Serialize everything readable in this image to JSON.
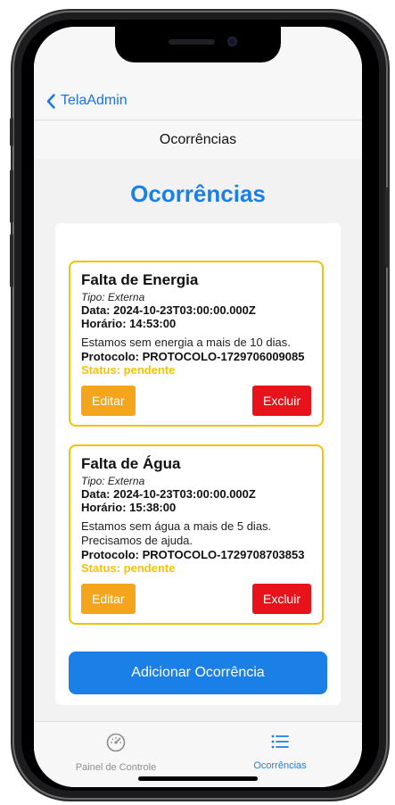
{
  "nav": {
    "back_label": "TelaAdmin",
    "title": "Ocorrências"
  },
  "page": {
    "heading": "Ocorrências"
  },
  "occurrences": [
    {
      "title": "Falta de Energia",
      "tipo": "Tipo: Externa",
      "data": "Data: 2024-10-23T03:00:00.000Z",
      "horario": "Horário: 14:53:00",
      "description": "Estamos sem energia a mais de 10 dias.",
      "protocol": "Protocolo: PROTOCOLO-1729706009085",
      "status": "Status: pendente",
      "edit_label": "Editar",
      "delete_label": "Excluir"
    },
    {
      "title": "Falta de Água",
      "tipo": "Tipo: Externa",
      "data": "Data: 2024-10-23T03:00:00.000Z",
      "horario": "Horário: 15:38:00",
      "description": "Estamos sem água a mais de 5 dias. Precisamos de ajuda.",
      "protocol": "Protocolo: PROTOCOLO-1729708703853",
      "status": "Status: pendente",
      "edit_label": "Editar",
      "delete_label": "Excluir"
    }
  ],
  "add_button_label": "Adicionar Ocorrência",
  "tabs": [
    {
      "label": "Painel de Controle",
      "icon": "speedometer-icon",
      "active": false
    },
    {
      "label": "Ocorrências",
      "icon": "list-icon",
      "active": true
    }
  ],
  "colors": {
    "accent": "#1b7fe8",
    "card_border": "#f2c20a",
    "edit": "#f4a51c",
    "delete": "#e8121b",
    "status": "#f2c20a"
  }
}
